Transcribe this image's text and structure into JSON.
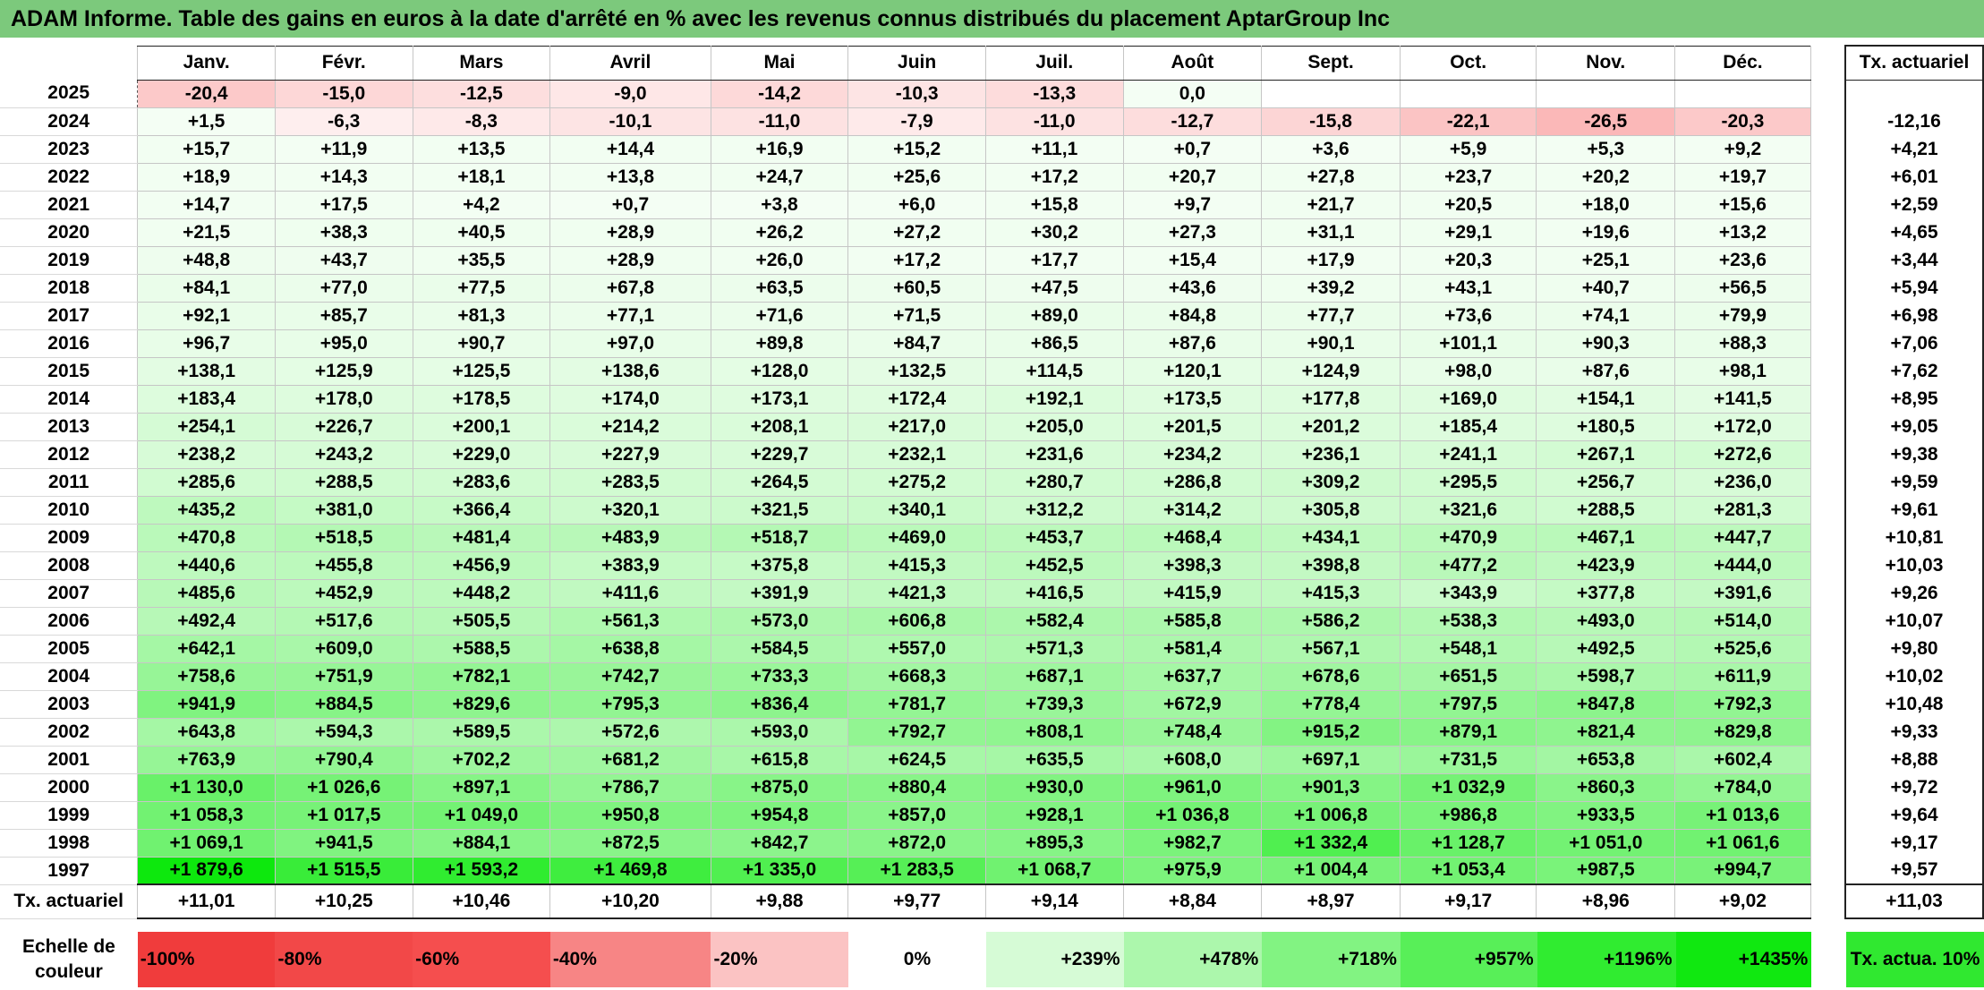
{
  "title": "ADAM Informe. Table des gains en euros à la date d'arrêté en % avec les revenus connus distribués du placement AptarGroup Inc",
  "months": [
    "Janv.",
    "Févr.",
    "Mars",
    "Avril",
    "Mai",
    "Juin",
    "Juil.",
    "Août",
    "Sept.",
    "Oct.",
    "Nov.",
    "Déc."
  ],
  "ta_header": "Tx. actuariel",
  "rows": [
    {
      "year": "2025",
      "values": [
        "-20,4",
        "-15,0",
        "-12,5",
        "-9,0",
        "-14,2",
        "-10,3",
        "-13,3",
        "0,0",
        "",
        "",
        "",
        ""
      ],
      "ta": ""
    },
    {
      "year": "2024",
      "values": [
        "+1,5",
        "-6,3",
        "-8,3",
        "-10,1",
        "-11,0",
        "-7,9",
        "-11,0",
        "-12,7",
        "-15,8",
        "-22,1",
        "-26,5",
        "-20,3"
      ],
      "ta": "-12,16"
    },
    {
      "year": "2023",
      "values": [
        "+15,7",
        "+11,9",
        "+13,5",
        "+14,4",
        "+16,9",
        "+15,2",
        "+11,1",
        "+0,7",
        "+3,6",
        "+5,9",
        "+5,3",
        "+9,2"
      ],
      "ta": "+4,21"
    },
    {
      "year": "2022",
      "values": [
        "+18,9",
        "+14,3",
        "+18,1",
        "+13,8",
        "+24,7",
        "+25,6",
        "+17,2",
        "+20,7",
        "+27,8",
        "+23,7",
        "+20,2",
        "+19,7"
      ],
      "ta": "+6,01"
    },
    {
      "year": "2021",
      "values": [
        "+14,7",
        "+17,5",
        "+4,2",
        "+0,7",
        "+3,8",
        "+6,0",
        "+15,8",
        "+9,7",
        "+21,7",
        "+20,5",
        "+18,0",
        "+15,6"
      ],
      "ta": "+2,59"
    },
    {
      "year": "2020",
      "values": [
        "+21,5",
        "+38,3",
        "+40,5",
        "+28,9",
        "+26,2",
        "+27,2",
        "+30,2",
        "+27,3",
        "+31,1",
        "+29,1",
        "+19,6",
        "+13,2"
      ],
      "ta": "+4,65"
    },
    {
      "year": "2019",
      "values": [
        "+48,8",
        "+43,7",
        "+35,5",
        "+28,9",
        "+26,0",
        "+17,2",
        "+17,7",
        "+15,4",
        "+17,9",
        "+20,3",
        "+25,1",
        "+23,6"
      ],
      "ta": "+3,44"
    },
    {
      "year": "2018",
      "values": [
        "+84,1",
        "+77,0",
        "+77,5",
        "+67,8",
        "+63,5",
        "+60,5",
        "+47,5",
        "+43,6",
        "+39,2",
        "+43,1",
        "+40,7",
        "+56,5"
      ],
      "ta": "+5,94"
    },
    {
      "year": "2017",
      "values": [
        "+92,1",
        "+85,7",
        "+81,3",
        "+77,1",
        "+71,6",
        "+71,5",
        "+89,0",
        "+84,8",
        "+77,7",
        "+73,6",
        "+74,1",
        "+79,9"
      ],
      "ta": "+6,98"
    },
    {
      "year": "2016",
      "values": [
        "+96,7",
        "+95,0",
        "+90,7",
        "+97,0",
        "+89,8",
        "+84,7",
        "+86,5",
        "+87,6",
        "+90,1",
        "+101,1",
        "+90,3",
        "+88,3"
      ],
      "ta": "+7,06"
    },
    {
      "year": "2015",
      "values": [
        "+138,1",
        "+125,9",
        "+125,5",
        "+138,6",
        "+128,0",
        "+132,5",
        "+114,5",
        "+120,1",
        "+124,9",
        "+98,0",
        "+87,6",
        "+98,1"
      ],
      "ta": "+7,62"
    },
    {
      "year": "2014",
      "values": [
        "+183,4",
        "+178,0",
        "+178,5",
        "+174,0",
        "+173,1",
        "+172,4",
        "+192,1",
        "+173,5",
        "+177,8",
        "+169,0",
        "+154,1",
        "+141,5"
      ],
      "ta": "+8,95"
    },
    {
      "year": "2013",
      "values": [
        "+254,1",
        "+226,7",
        "+200,1",
        "+214,2",
        "+208,1",
        "+217,0",
        "+205,0",
        "+201,5",
        "+201,2",
        "+185,4",
        "+180,5",
        "+172,0"
      ],
      "ta": "+9,05"
    },
    {
      "year": "2012",
      "values": [
        "+238,2",
        "+243,2",
        "+229,0",
        "+227,9",
        "+229,7",
        "+232,1",
        "+231,6",
        "+234,2",
        "+236,1",
        "+241,1",
        "+267,1",
        "+272,6"
      ],
      "ta": "+9,38"
    },
    {
      "year": "2011",
      "values": [
        "+285,6",
        "+288,5",
        "+283,6",
        "+283,5",
        "+264,5",
        "+275,2",
        "+280,7",
        "+286,8",
        "+309,2",
        "+295,5",
        "+256,7",
        "+236,0"
      ],
      "ta": "+9,59"
    },
    {
      "year": "2010",
      "values": [
        "+435,2",
        "+381,0",
        "+366,4",
        "+320,1",
        "+321,5",
        "+340,1",
        "+312,2",
        "+314,2",
        "+305,8",
        "+321,6",
        "+288,5",
        "+281,3"
      ],
      "ta": "+9,61"
    },
    {
      "year": "2009",
      "values": [
        "+470,8",
        "+518,5",
        "+481,4",
        "+483,9",
        "+518,7",
        "+469,0",
        "+453,7",
        "+468,4",
        "+434,1",
        "+470,9",
        "+467,1",
        "+447,7"
      ],
      "ta": "+10,81"
    },
    {
      "year": "2008",
      "values": [
        "+440,6",
        "+455,8",
        "+456,9",
        "+383,9",
        "+375,8",
        "+415,3",
        "+452,5",
        "+398,3",
        "+398,8",
        "+477,2",
        "+423,9",
        "+444,0"
      ],
      "ta": "+10,03"
    },
    {
      "year": "2007",
      "values": [
        "+485,6",
        "+452,9",
        "+448,2",
        "+411,6",
        "+391,9",
        "+421,3",
        "+416,5",
        "+415,9",
        "+415,3",
        "+343,9",
        "+377,8",
        "+391,6"
      ],
      "ta": "+9,26"
    },
    {
      "year": "2006",
      "values": [
        "+492,4",
        "+517,6",
        "+505,5",
        "+561,3",
        "+573,0",
        "+606,8",
        "+582,4",
        "+585,8",
        "+586,2",
        "+538,3",
        "+493,0",
        "+514,0"
      ],
      "ta": "+10,07"
    },
    {
      "year": "2005",
      "values": [
        "+642,1",
        "+609,0",
        "+588,5",
        "+638,8",
        "+584,5",
        "+557,0",
        "+571,3",
        "+581,4",
        "+567,1",
        "+548,1",
        "+492,5",
        "+525,6"
      ],
      "ta": "+9,80"
    },
    {
      "year": "2004",
      "values": [
        "+758,6",
        "+751,9",
        "+782,1",
        "+742,7",
        "+733,3",
        "+668,3",
        "+687,1",
        "+637,7",
        "+678,6",
        "+651,5",
        "+598,7",
        "+611,9"
      ],
      "ta": "+10,02"
    },
    {
      "year": "2003",
      "values": [
        "+941,9",
        "+884,5",
        "+829,6",
        "+795,3",
        "+836,4",
        "+781,7",
        "+739,3",
        "+672,9",
        "+778,4",
        "+797,5",
        "+847,8",
        "+792,3"
      ],
      "ta": "+10,48"
    },
    {
      "year": "2002",
      "values": [
        "+643,8",
        "+594,3",
        "+589,5",
        "+572,6",
        "+593,0",
        "+792,7",
        "+808,1",
        "+748,4",
        "+915,2",
        "+879,1",
        "+821,4",
        "+829,8"
      ],
      "ta": "+9,33"
    },
    {
      "year": "2001",
      "values": [
        "+763,9",
        "+790,4",
        "+702,2",
        "+681,2",
        "+615,8",
        "+624,5",
        "+635,5",
        "+608,0",
        "+697,1",
        "+731,5",
        "+653,8",
        "+602,4"
      ],
      "ta": "+8,88"
    },
    {
      "year": "2000",
      "values": [
        "+1 130,0",
        "+1 026,6",
        "+897,1",
        "+786,7",
        "+875,0",
        "+880,4",
        "+930,0",
        "+961,0",
        "+901,3",
        "+1 032,9",
        "+860,3",
        "+784,0"
      ],
      "ta": "+9,72"
    },
    {
      "year": "1999",
      "values": [
        "+1 058,3",
        "+1 017,5",
        "+1 049,0",
        "+950,8",
        "+954,8",
        "+857,0",
        "+928,1",
        "+1 036,8",
        "+1 006,8",
        "+986,8",
        "+933,5",
        "+1 013,6"
      ],
      "ta": "+9,64"
    },
    {
      "year": "1998",
      "values": [
        "+1 069,1",
        "+941,5",
        "+884,1",
        "+872,5",
        "+842,7",
        "+872,0",
        "+895,3",
        "+982,7",
        "+1 332,4",
        "+1 128,7",
        "+1 051,0",
        "+1 061,6"
      ],
      "ta": "+9,17"
    },
    {
      "year": "1997",
      "values": [
        "+1 879,6",
        "+1 515,5",
        "+1 593,2",
        "+1 469,8",
        "+1 335,0",
        "+1 283,5",
        "+1 068,7",
        "+975,9",
        "+1 004,4",
        "+1 053,4",
        "+987,5",
        "+994,7"
      ],
      "ta": "+9,57"
    }
  ],
  "total": {
    "label": "Tx. actuariel",
    "values": [
      "+11,01",
      "+10,25",
      "+10,46",
      "+10,20",
      "+9,88",
      "+9,77",
      "+9,14",
      "+8,84",
      "+8,97",
      "+9,17",
      "+8,96",
      "+9,02"
    ],
    "ta": "+11,03"
  },
  "legend": {
    "label": "Echelle de couleur",
    "items": [
      {
        "text": "-100%",
        "color": "#f03c3c"
      },
      {
        "text": "-80%",
        "color": "#f24848"
      },
      {
        "text": "-60%",
        "color": "#f54e4e"
      },
      {
        "text": "-40%",
        "color": "#f78585"
      },
      {
        "text": "-20%",
        "color": "#fbc3c3"
      },
      {
        "text": "0%",
        "color": "#ffffff"
      },
      {
        "text": "+239%",
        "color": "#d6fbd6"
      },
      {
        "text": "+478%",
        "color": "#acf7ac"
      },
      {
        "text": "+718%",
        "color": "#82f382"
      },
      {
        "text": "+957%",
        "color": "#58ef58"
      },
      {
        "text": "+1196%",
        "color": "#30ec30"
      },
      {
        "text": "+1435%",
        "color": "#10e810"
      }
    ],
    "actual": {
      "text": "Tx. actua. 10%",
      "color": "#30e830"
    }
  }
}
